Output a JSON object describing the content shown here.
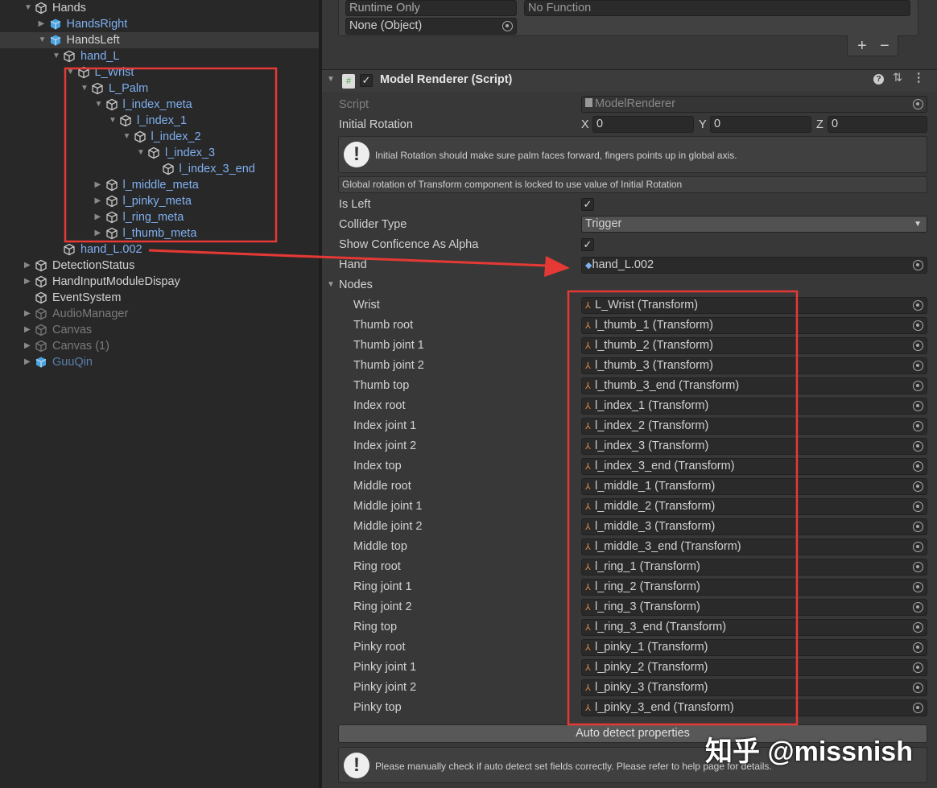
{
  "hierarchy": [
    {
      "label": "Hands",
      "depth": 0,
      "arrow": "down",
      "icon": "cube",
      "style": "normal"
    },
    {
      "label": "HandsRight",
      "depth": 1,
      "arrow": "right",
      "icon": "prefab",
      "style": "blue"
    },
    {
      "label": "HandsLeft",
      "depth": 1,
      "arrow": "down",
      "icon": "prefab",
      "style": "normal",
      "selected": true
    },
    {
      "label": "hand_L",
      "depth": 2,
      "arrow": "down",
      "icon": "cube",
      "style": "blue"
    },
    {
      "label": "L_Wrist",
      "depth": 3,
      "arrow": "down",
      "icon": "cube",
      "style": "blue"
    },
    {
      "label": "L_Palm",
      "depth": 4,
      "arrow": "down",
      "icon": "cube",
      "style": "blue"
    },
    {
      "label": "l_index_meta",
      "depth": 5,
      "arrow": "down",
      "icon": "cube",
      "style": "blue"
    },
    {
      "label": "l_index_1",
      "depth": 6,
      "arrow": "down",
      "icon": "cube",
      "style": "blue"
    },
    {
      "label": "l_index_2",
      "depth": 7,
      "arrow": "down",
      "icon": "cube",
      "style": "blue"
    },
    {
      "label": "l_index_3",
      "depth": 8,
      "arrow": "down",
      "icon": "cube",
      "style": "blue"
    },
    {
      "label": "l_index_3_end",
      "depth": 9,
      "arrow": "",
      "icon": "cube",
      "style": "blue"
    },
    {
      "label": "l_middle_meta",
      "depth": 5,
      "arrow": "right",
      "icon": "cube",
      "style": "blue"
    },
    {
      "label": "l_pinky_meta",
      "depth": 5,
      "arrow": "right",
      "icon": "cube",
      "style": "blue"
    },
    {
      "label": "l_ring_meta",
      "depth": 5,
      "arrow": "right",
      "icon": "cube",
      "style": "blue"
    },
    {
      "label": "l_thumb_meta",
      "depth": 5,
      "arrow": "right",
      "icon": "cube",
      "style": "blue"
    },
    {
      "label": "hand_L.002",
      "depth": 2,
      "arrow": "",
      "icon": "cube",
      "style": "blue"
    },
    {
      "label": "DetectionStatus",
      "depth": 0,
      "arrow": "right",
      "icon": "cube",
      "style": "normal"
    },
    {
      "label": "HandInputModuleDispay",
      "depth": 0,
      "arrow": "right",
      "icon": "cube",
      "style": "normal"
    },
    {
      "label": "EventSystem",
      "depth": 0,
      "arrow": "",
      "icon": "cube",
      "style": "normal"
    },
    {
      "label": "AudioManager",
      "depth": 0,
      "arrow": "right",
      "icon": "cube",
      "style": "dim"
    },
    {
      "label": "Canvas",
      "depth": 0,
      "arrow": "right",
      "icon": "cube",
      "style": "dim"
    },
    {
      "label": "Canvas (1)",
      "depth": 0,
      "arrow": "right",
      "icon": "cube",
      "style": "dim"
    },
    {
      "label": "GuuQin",
      "depth": 0,
      "arrow": "right",
      "icon": "prefab",
      "style": "dimblue"
    }
  ],
  "event": {
    "runtime": "Runtime Only",
    "function": "No Function",
    "object": "None (Object)",
    "add": "+",
    "remove": "−"
  },
  "component": {
    "title": "Model Renderer (Script)",
    "enabled": true
  },
  "props": {
    "script_label": "Script",
    "script_value": "ModelRenderer",
    "rotation_label": "Initial Rotation",
    "x_label": "X",
    "x": "0",
    "y_label": "Y",
    "y": "0",
    "z_label": "Z",
    "z": "0",
    "rotation_help": "Initial Rotation should make sure palm faces forward, fingers points up in global axis.",
    "rotation_note": "Global rotation of Transform component is locked to use value of Initial Rotation",
    "isleft_label": "Is Left",
    "isleft": true,
    "collider_label": "Collider Type",
    "collider": "Trigger",
    "alpha_label": "Show Conficence As Alpha",
    "alpha": true,
    "hand_label": "Hand",
    "hand": "hand_L.002",
    "nodes_label": "Nodes"
  },
  "nodes": [
    {
      "label": "Wrist",
      "value": "L_Wrist (Transform)"
    },
    {
      "label": "Thumb root",
      "value": "l_thumb_1 (Transform)"
    },
    {
      "label": "Thumb joint 1",
      "value": "l_thumb_2 (Transform)"
    },
    {
      "label": "Thumb joint 2",
      "value": "l_thumb_3 (Transform)"
    },
    {
      "label": "Thumb top",
      "value": "l_thumb_3_end (Transform)"
    },
    {
      "label": "Index root",
      "value": "l_index_1 (Transform)"
    },
    {
      "label": "Index joint 1",
      "value": "l_index_2 (Transform)"
    },
    {
      "label": "Index joint 2",
      "value": "l_index_3 (Transform)"
    },
    {
      "label": "Index top",
      "value": "l_index_3_end (Transform)"
    },
    {
      "label": "Middle root",
      "value": "l_middle_1 (Transform)"
    },
    {
      "label": "Middle joint 1",
      "value": "l_middle_2 (Transform)"
    },
    {
      "label": "Middle joint 2",
      "value": "l_middle_3 (Transform)"
    },
    {
      "label": "Middle top",
      "value": "l_middle_3_end (Transform)"
    },
    {
      "label": "Ring root",
      "value": "l_ring_1 (Transform)"
    },
    {
      "label": "Ring joint 1",
      "value": "l_ring_2 (Transform)"
    },
    {
      "label": "Ring joint 2",
      "value": "l_ring_3 (Transform)"
    },
    {
      "label": "Ring top",
      "value": "l_ring_3_end (Transform)"
    },
    {
      "label": "Pinky root",
      "value": "l_pinky_1 (Transform)"
    },
    {
      "label": "Pinky joint 1",
      "value": "l_pinky_2 (Transform)"
    },
    {
      "label": "Pinky joint 2",
      "value": "l_pinky_3 (Transform)"
    },
    {
      "label": "Pinky top",
      "value": "l_pinky_3_end (Transform)"
    }
  ],
  "auto_detect": "Auto detect properties",
  "auto_help": "Please manually check if auto detect set fields correctly. Please refer to help page for details.",
  "watermark": "知乎 @missnish",
  "colors": {
    "annotation": "#e53935",
    "blue_text": "#7fb0ef"
  }
}
